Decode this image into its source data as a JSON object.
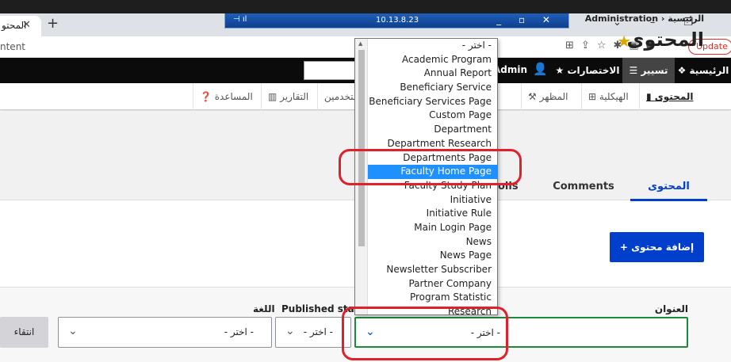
{
  "browser": {
    "tab_title": "المحتو",
    "tab_close": "✕",
    "new_tab": "+",
    "window_controls": [
      "⌄",
      "–",
      "❐"
    ],
    "url_fragment": "ntent",
    "update_label": "Update",
    "remote_ip": "10.13.8.23",
    "remote_controls": "_ ▫ ✕"
  },
  "toolbar": {
    "home": "الرئيسية",
    "manage": "تسيير",
    "shortcuts": "الاختصارات",
    "user": "Admin"
  },
  "menu": {
    "content": "المحتوى",
    "structure": "الهيكلية",
    "appearance": "المظهر",
    "people": "مستخدمين",
    "reports": "التقارير",
    "help": "المساعدة"
  },
  "page": {
    "breadcrumb_home": "الرئيسية",
    "breadcrumb_sep": "›",
    "breadcrumb_admin": "Administration",
    "title": "المحتوى",
    "tabs": {
      "content": "المحتوى",
      "comments": "Comments",
      "partial": "olls"
    },
    "add_button": "+ إضافة محتوى"
  },
  "filters": {
    "title_label": "العنوان",
    "status_label": "Published status",
    "language_label": "اللغة",
    "placeholder": "- اختر -",
    "apply": "انتقاء"
  },
  "dropdown": {
    "selected": "Faculty Home Page",
    "options": [
      "- اختر -",
      "Academic Program",
      "Annual Report",
      "Beneficiary Service",
      "Beneficiary Services Page",
      "Custom Page",
      "Department",
      "Department Research",
      "Departments Page",
      "Faculty Home Page",
      "Faculty Study Plan",
      "Initiative",
      "Initiative Rule",
      "Main Login Page",
      "News",
      "News Page",
      "Newsletter Subscriber",
      "Partner Company",
      "Program Statistic",
      "Research"
    ]
  },
  "colors": {
    "accent": "#003ecc",
    "highlight": "#1e90ff",
    "annotation": "#e0202a",
    "focus": "#1b8a3a"
  }
}
